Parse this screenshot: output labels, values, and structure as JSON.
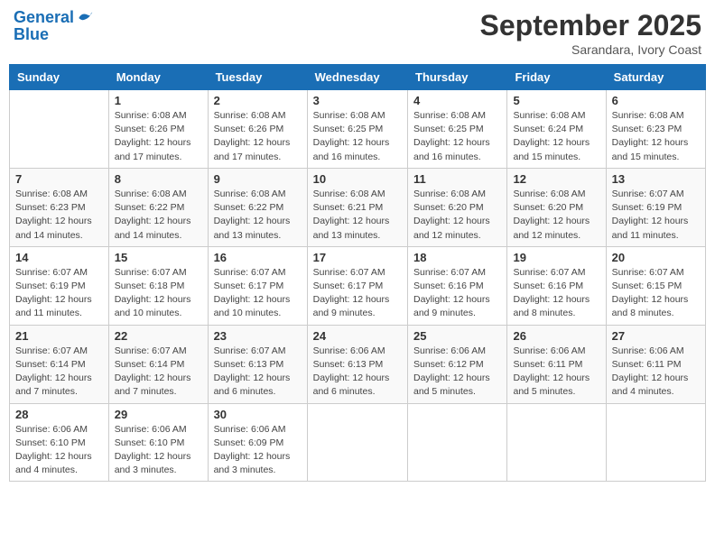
{
  "header": {
    "logo_line1": "General",
    "logo_line2": "Blue",
    "month": "September 2025",
    "location": "Sarandara, Ivory Coast"
  },
  "days_of_week": [
    "Sunday",
    "Monday",
    "Tuesday",
    "Wednesday",
    "Thursday",
    "Friday",
    "Saturday"
  ],
  "weeks": [
    [
      {
        "day": "",
        "info": ""
      },
      {
        "day": "1",
        "info": "Sunrise: 6:08 AM\nSunset: 6:26 PM\nDaylight: 12 hours\nand 17 minutes."
      },
      {
        "day": "2",
        "info": "Sunrise: 6:08 AM\nSunset: 6:26 PM\nDaylight: 12 hours\nand 17 minutes."
      },
      {
        "day": "3",
        "info": "Sunrise: 6:08 AM\nSunset: 6:25 PM\nDaylight: 12 hours\nand 16 minutes."
      },
      {
        "day": "4",
        "info": "Sunrise: 6:08 AM\nSunset: 6:25 PM\nDaylight: 12 hours\nand 16 minutes."
      },
      {
        "day": "5",
        "info": "Sunrise: 6:08 AM\nSunset: 6:24 PM\nDaylight: 12 hours\nand 15 minutes."
      },
      {
        "day": "6",
        "info": "Sunrise: 6:08 AM\nSunset: 6:23 PM\nDaylight: 12 hours\nand 15 minutes."
      }
    ],
    [
      {
        "day": "7",
        "info": "Sunrise: 6:08 AM\nSunset: 6:23 PM\nDaylight: 12 hours\nand 14 minutes."
      },
      {
        "day": "8",
        "info": "Sunrise: 6:08 AM\nSunset: 6:22 PM\nDaylight: 12 hours\nand 14 minutes."
      },
      {
        "day": "9",
        "info": "Sunrise: 6:08 AM\nSunset: 6:22 PM\nDaylight: 12 hours\nand 13 minutes."
      },
      {
        "day": "10",
        "info": "Sunrise: 6:08 AM\nSunset: 6:21 PM\nDaylight: 12 hours\nand 13 minutes."
      },
      {
        "day": "11",
        "info": "Sunrise: 6:08 AM\nSunset: 6:20 PM\nDaylight: 12 hours\nand 12 minutes."
      },
      {
        "day": "12",
        "info": "Sunrise: 6:08 AM\nSunset: 6:20 PM\nDaylight: 12 hours\nand 12 minutes."
      },
      {
        "day": "13",
        "info": "Sunrise: 6:07 AM\nSunset: 6:19 PM\nDaylight: 12 hours\nand 11 minutes."
      }
    ],
    [
      {
        "day": "14",
        "info": "Sunrise: 6:07 AM\nSunset: 6:19 PM\nDaylight: 12 hours\nand 11 minutes."
      },
      {
        "day": "15",
        "info": "Sunrise: 6:07 AM\nSunset: 6:18 PM\nDaylight: 12 hours\nand 10 minutes."
      },
      {
        "day": "16",
        "info": "Sunrise: 6:07 AM\nSunset: 6:17 PM\nDaylight: 12 hours\nand 10 minutes."
      },
      {
        "day": "17",
        "info": "Sunrise: 6:07 AM\nSunset: 6:17 PM\nDaylight: 12 hours\nand 9 minutes."
      },
      {
        "day": "18",
        "info": "Sunrise: 6:07 AM\nSunset: 6:16 PM\nDaylight: 12 hours\nand 9 minutes."
      },
      {
        "day": "19",
        "info": "Sunrise: 6:07 AM\nSunset: 6:16 PM\nDaylight: 12 hours\nand 8 minutes."
      },
      {
        "day": "20",
        "info": "Sunrise: 6:07 AM\nSunset: 6:15 PM\nDaylight: 12 hours\nand 8 minutes."
      }
    ],
    [
      {
        "day": "21",
        "info": "Sunrise: 6:07 AM\nSunset: 6:14 PM\nDaylight: 12 hours\nand 7 minutes."
      },
      {
        "day": "22",
        "info": "Sunrise: 6:07 AM\nSunset: 6:14 PM\nDaylight: 12 hours\nand 7 minutes."
      },
      {
        "day": "23",
        "info": "Sunrise: 6:07 AM\nSunset: 6:13 PM\nDaylight: 12 hours\nand 6 minutes."
      },
      {
        "day": "24",
        "info": "Sunrise: 6:06 AM\nSunset: 6:13 PM\nDaylight: 12 hours\nand 6 minutes."
      },
      {
        "day": "25",
        "info": "Sunrise: 6:06 AM\nSunset: 6:12 PM\nDaylight: 12 hours\nand 5 minutes."
      },
      {
        "day": "26",
        "info": "Sunrise: 6:06 AM\nSunset: 6:11 PM\nDaylight: 12 hours\nand 5 minutes."
      },
      {
        "day": "27",
        "info": "Sunrise: 6:06 AM\nSunset: 6:11 PM\nDaylight: 12 hours\nand 4 minutes."
      }
    ],
    [
      {
        "day": "28",
        "info": "Sunrise: 6:06 AM\nSunset: 6:10 PM\nDaylight: 12 hours\nand 4 minutes."
      },
      {
        "day": "29",
        "info": "Sunrise: 6:06 AM\nSunset: 6:10 PM\nDaylight: 12 hours\nand 3 minutes."
      },
      {
        "day": "30",
        "info": "Sunrise: 6:06 AM\nSunset: 6:09 PM\nDaylight: 12 hours\nand 3 minutes."
      },
      {
        "day": "",
        "info": ""
      },
      {
        "day": "",
        "info": ""
      },
      {
        "day": "",
        "info": ""
      },
      {
        "day": "",
        "info": ""
      }
    ]
  ]
}
